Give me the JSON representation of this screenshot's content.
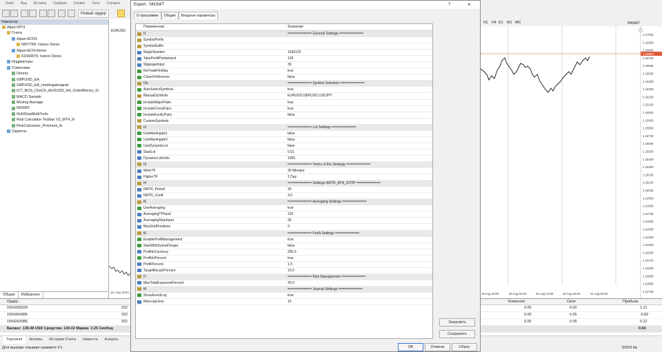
{
  "menu": [
    "Файл",
    "Вид",
    "Вставка",
    "Графики",
    "Сервис",
    "Окно",
    "Справка"
  ],
  "toolbar": {
    "new_order": "Новый ордер"
  },
  "navigator": {
    "title": "Навигатор",
    "items": [
      {
        "label": "Alpari MT4",
        "indent": 0,
        "color": "#d9b34a"
      },
      {
        "label": "Счета",
        "indent": 1,
        "color": "#d9b34a"
      },
      {
        "label": "Alpari-ECN1",
        "indent": 2,
        "color": "#6a9fd8"
      },
      {
        "label": "5807789: Ivanov Denis",
        "indent": 3,
        "color": "#e0b440"
      },
      {
        "label": "Alpari-ECN-Demo",
        "indent": 2,
        "color": "#6a9fd8"
      },
      {
        "label": "61669879: Ivanov Denis",
        "indent": 3,
        "color": "#e0b440"
      },
      {
        "label": "Индикаторы",
        "indent": 1,
        "color": "#6a9fd8"
      },
      {
        "label": "Советники",
        "indent": 1,
        "color": "#6a9fd8"
      },
      {
        "label": "Dennis",
        "indent": 2,
        "color": "#7ab07a"
      },
      {
        "label": "GBPUSD_EA",
        "indent": 2,
        "color": "#7ab07a"
      },
      {
        "label": "GBPUSD_EA_martingalesignal",
        "indent": 2,
        "color": "#7ab07a"
      },
      {
        "label": "ICT_BOS_ChoCh_AUDUSD_H4_OrderBlocks_Si",
        "indent": 2,
        "color": "#7ab07a"
      },
      {
        "label": "MACD Sample",
        "indent": 2,
        "color": "#7ab07a"
      },
      {
        "label": "Moving Average",
        "indent": 2,
        "color": "#7ab07a"
      },
      {
        "label": "NNSMT",
        "indent": 2,
        "color": "#7ab07a"
      },
      {
        "label": "NoNStopMultiTools",
        "indent": 2,
        "color": "#7ab07a"
      },
      {
        "label": "Risk Calculator Toolbar V3_MT4_fx",
        "indent": 2,
        "color": "#7ab07a"
      },
      {
        "label": "RiskCalculator_Premium_fx",
        "indent": 2,
        "color": "#7ab07a"
      },
      {
        "label": "Скрипты",
        "indent": 1,
        "color": "#6a9fd8"
      }
    ],
    "tabs": [
      "Общие",
      "Избранное"
    ]
  },
  "chart_left": {
    "symbol": "EURUSD",
    "date": "12 Aug 2024"
  },
  "chart_right": {
    "title": "NNSMT",
    "timeframes": [
      "H1",
      "H4",
      "D1",
      "W1",
      "MN"
    ],
    "prices": [
      "1.17030",
      "1.16930",
      "1.16830",
      "1.16730",
      "1.16630",
      "1.16530",
      "1.16430",
      "1.16330",
      "1.16230",
      "1.16130",
      "1.16030",
      "1.15930",
      "1.15830",
      "1.15730",
      "1.15630",
      "1.15530",
      "1.15430",
      "1.15330",
      "1.15230",
      "1.15130",
      "1.15030",
      "1.14930",
      "1.14830",
      "1.14730",
      "1.14630",
      "1.14530",
      "1.14430",
      "1.14330",
      "1.14230",
      "1.14130",
      "1.14030",
      "1.13930",
      "1.13830",
      "1.13730"
    ],
    "current_price": "1.16994",
    "dates": [
      "19 Aug 20:00",
      "20 Aug 04:00",
      "20 Aug 12:00",
      "20 Aug 20:00",
      "21 Aug 04:00"
    ]
  },
  "terminal": {
    "headers": {
      "order": "Ордер",
      "commission": "Комиссия",
      "swap": "Своп",
      "profit": "Прибыль"
    },
    "rows": [
      {
        "order": "1554260529",
        "time": "202",
        "commission": "0.00",
        "swap": "0.00",
        "profit": "1.21"
      },
      {
        "order": "1554264385",
        "time": "202",
        "commission": "0.00",
        "swap": "0.05",
        "profit": "-0.82"
      },
      {
        "order": "1554264386",
        "time": "202",
        "commission": "0.00",
        "swap": "0.05",
        "profit": "0.12"
      }
    ],
    "balance": "Баланс: 139.48 USD  Средства: 140.02  Маржа: 3.25  Свобод",
    "total_profit": "0.54",
    "tabs": [
      "Торговля",
      "Активы",
      "История Счета",
      "Новости",
      "Алерты"
    ]
  },
  "status": {
    "help": "Для вызова справки нажмите F1",
    "traffic": "655/3 kb"
  },
  "dialog": {
    "title": "Expert - NNSMT",
    "help": "?",
    "close": "×",
    "tabs": [
      "О программе",
      "Общие",
      "Входные параметры"
    ],
    "col_variable": "Переменная",
    "col_value": "Значение",
    "load": "Загрузить",
    "save": "Сохранить",
    "ok": "OK",
    "cancel": "Отмена",
    "reset": "Сброс",
    "params": [
      {
        "name": "t1",
        "value": "============ General Settings ============",
        "kind": "ab",
        "sep": true
      },
      {
        "name": "SymbolPrefix",
        "value": "",
        "kind": "ab"
      },
      {
        "name": "SymbolSuffix",
        "value": "",
        "kind": "ab"
      },
      {
        "name": "MagicNumber",
        "value": "1030120",
        "kind": "num"
      },
      {
        "name": "TakeProfitPointsInput",
        "value": "120",
        "kind": "num"
      },
      {
        "name": "SlippageInput",
        "value": "30",
        "kind": "num"
      },
      {
        "name": "NoTradeHoliday",
        "value": "true",
        "kind": "bool"
      },
      {
        "name": "CloseOnReverse",
        "value": "false",
        "kind": "bool"
      },
      {
        "name": "t1b",
        "value": "============ Symbol Selection ============",
        "kind": "ab",
        "sep": true
      },
      {
        "name": "AutoSelectSymbols",
        "value": "true",
        "kind": "bool"
      },
      {
        "name": "ManualSymbols",
        "value": "EURUSD,GBPUSD,USDJPY",
        "kind": "ab"
      },
      {
        "name": "IncludeMajorPairs",
        "value": "true",
        "kind": "bool"
      },
      {
        "name": "IncludeCrossPairs",
        "value": "true",
        "kind": "bool"
      },
      {
        "name": "IncludeExoticPairs",
        "value": "false",
        "kind": "bool"
      },
      {
        "name": "CustomSymbols",
        "value": "",
        "kind": "ab"
      },
      {
        "name": "t2",
        "value": "============ Lot Settings ============",
        "kind": "ab",
        "sep": true
      },
      {
        "name": "UseMartingale1",
        "value": "false",
        "kind": "bool"
      },
      {
        "name": "UseMartingale2",
        "value": "false",
        "kind": "bool"
      },
      {
        "name": "UseDynamicLot",
        "value": "false",
        "kind": "bool"
      },
      {
        "name": "StartLot",
        "value": "0.01",
        "kind": "num"
      },
      {
        "name": "DynamicLotUnits",
        "value": "1000",
        "kind": "num"
      },
      {
        "name": "t3",
        "value": "============ Terms of the Strategy ============",
        "kind": "ab",
        "sep": true
      },
      {
        "name": "WorkTF",
        "value": "30 Minutes",
        "kind": "num"
      },
      {
        "name": "HigherTF",
        "value": "1 Day",
        "kind": "num"
      },
      {
        "name": "t4",
        "value": "============ Settings NRTR_ATR_STOP ============",
        "kind": "ab",
        "sep": true
      },
      {
        "name": "NRTR_Period",
        "value": "30",
        "kind": "num"
      },
      {
        "name": "NRTR_Coeff",
        "value": "3.0",
        "kind": "num"
      },
      {
        "name": "t5",
        "value": "============ Averaging Settings ============",
        "kind": "ab",
        "sep": true
      },
      {
        "name": "UseAveraging",
        "value": "true",
        "kind": "bool"
      },
      {
        "name": "AveragingTPInput",
        "value": "120",
        "kind": "num"
      },
      {
        "name": "AveragingStepInput",
        "value": "30",
        "kind": "num"
      },
      {
        "name": "MaxGridPositions",
        "value": "3",
        "kind": "num"
      },
      {
        "name": "t6",
        "value": "============ Profit Settings ============",
        "kind": "ab",
        "sep": true
      },
      {
        "name": "EnableProfitManagement",
        "value": "true",
        "kind": "bool"
      },
      {
        "name": "StartWithSumedTarget",
        "value": "false",
        "kind": "bool"
      },
      {
        "name": "ProfitInCurrency",
        "value": "200.0",
        "kind": "num"
      },
      {
        "name": "ProfitInPercent",
        "value": "true",
        "kind": "bool"
      },
      {
        "name": "ProfitPercent",
        "value": "1.5",
        "kind": "num"
      },
      {
        "name": "TargetRecalcPercent",
        "value": "10.0",
        "kind": "num"
      },
      {
        "name": "t7",
        "value": "============ Risk Management ============",
        "kind": "ab",
        "sep": true
      },
      {
        "name": "MaxTotalExposurePercent",
        "value": "30.0",
        "kind": "num"
      },
      {
        "name": "t8",
        "value": "============ Journal Settings ============",
        "kind": "ab",
        "sep": true
      },
      {
        "name": "ShowEventLog",
        "value": "true",
        "kind": "bool"
      },
      {
        "name": "MaxLogLines",
        "value": "15",
        "kind": "num"
      }
    ]
  },
  "colors": {
    "accent": "#0a2f7a",
    "sep_row": "#e8e8e8",
    "price_line": "#e05a3a",
    "bool_icon": "#3d9a3d",
    "num_icon": "#4a7fc0",
    "ab_icon": "#b89a3a"
  }
}
